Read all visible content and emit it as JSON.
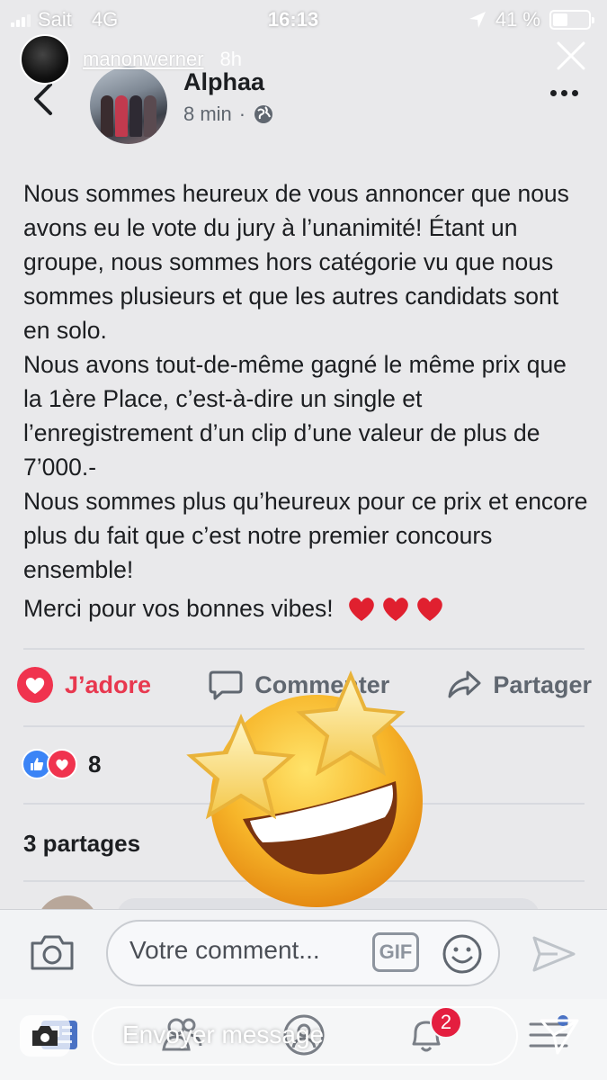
{
  "status_bar": {
    "carrier": "Sait",
    "network": "4G",
    "time": "16:13",
    "battery": "41 %",
    "battery_level": 0.41
  },
  "story": {
    "username": "manonwerner",
    "time_ago": "8h",
    "reply_placeholder": "Envoyer message",
    "sticker": "star-struck-emoji"
  },
  "post": {
    "author": "Alphaa",
    "time": "8 min",
    "privacy_icon": "globe-icon",
    "paragraphs": [
      "Nous sommes heureux de vous annoncer que nous avons eu le vote du jury à l’unanimité! Étant un groupe, nous sommes hors catégorie vu que nous sommes plusieurs et que les autres candidats sont en solo.",
      "Nous avons tout-de-même gagné le même prix que la 1ère Place, c’est-à-dire un single et l’enregistrement d’un clip d’une valeur de plus de 7’000.-",
      "Nous sommes plus qu’heureux pour ce prix et encore plus du fait que c’est notre premier concours ensemble!"
    ],
    "thanks": "Merci pour vos bonnes vibes!",
    "hearts": 3
  },
  "actions": {
    "like": "J’adore",
    "comment": "Commenter",
    "share": "Partager"
  },
  "reactions": {
    "count": "8"
  },
  "shares": "3 partages",
  "comment_bar": {
    "placeholder": "Votre comment...",
    "gif": "GIF"
  },
  "nav": {
    "notifications_badge": "2"
  },
  "colors": {
    "love": "#f0334e",
    "like": "#3b84f6",
    "text": "#1c1e21",
    "meta": "#606770"
  }
}
